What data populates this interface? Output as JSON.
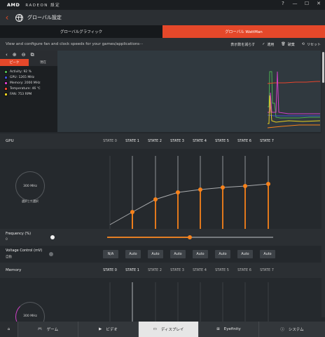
{
  "titlebar": {
    "brand": "AMD",
    "product": "RADEON 設定",
    "buttons": [
      "?",
      "—",
      "☐",
      "✕"
    ]
  },
  "header": {
    "title": "グローバル設定"
  },
  "tabs": [
    {
      "label": "グローバルグラフィック",
      "active": false
    },
    {
      "label": "グローバル WattMan",
      "active": true
    }
  ],
  "description": {
    "text": "View and configure fan and clock speeds for your games/applications···",
    "show_less": "表示数を減らす",
    "apply": "適用",
    "discard": "破棄",
    "reset": "リセット"
  },
  "monitor": {
    "tabs": [
      "ピーク",
      "現在"
    ],
    "legend": [
      {
        "label": "Activity: 92 %",
        "color": "#4caf50"
      },
      {
        "label": "GPU: 1265 MHz",
        "color": "#3f51d5"
      },
      {
        "label": "Memory: 2000 MHz",
        "color": "#d040c8"
      },
      {
        "label": "Temperature: 46 ℃",
        "color": "#e8452c"
      },
      {
        "label": "FAN: 753 RPM",
        "color": "#e8d020"
      }
    ]
  },
  "gpu": {
    "section_label": "GPU",
    "states": [
      "STATE 0",
      "STATE 1",
      "STATE 2",
      "STATE 3",
      "STATE 4",
      "STATE 5",
      "STATE 6",
      "STATE 7"
    ],
    "dial_value": "300 MHz",
    "dial_caption": "選択した選択",
    "frequency_label": "Frequency (%)",
    "frequency_value": "0",
    "frequency_percent": 0,
    "voltage_label": "Voltage Control (mV)",
    "voltage_mode": "自動",
    "voltage_values": [
      "N/A",
      "Auto",
      "Auto",
      "Auto",
      "Auto",
      "Auto",
      "Auto",
      "Auto"
    ]
  },
  "memory": {
    "section_label": "Memory",
    "states": [
      "STATE 0",
      "STATE 1",
      "STATE 2",
      "STATE 3",
      "STATE 4",
      "STATE 5",
      "STATE 6",
      "STATE 7"
    ],
    "dial_value": "300 MHz"
  },
  "bottom_nav": [
    {
      "label": "",
      "icon": "home-icon"
    },
    {
      "label": "ゲーム",
      "icon": "gamepad-icon"
    },
    {
      "label": "ビデオ",
      "icon": "play-icon"
    },
    {
      "label": "ディスプレイ",
      "icon": "display-icon",
      "selected": true
    },
    {
      "label": "Eyefinity",
      "icon": "eyefinity-icon"
    },
    {
      "label": "システム",
      "icon": "info-icon"
    }
  ],
  "colors": {
    "accent": "#e5482a",
    "curve": "#f7821b"
  }
}
